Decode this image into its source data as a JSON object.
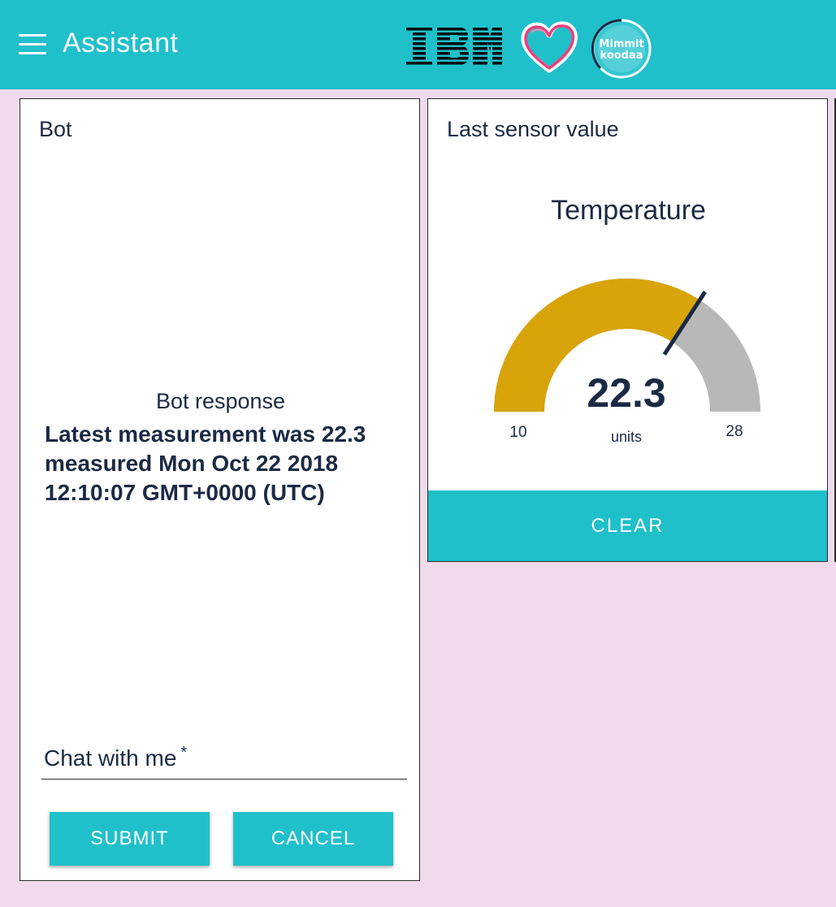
{
  "header": {
    "title": "Assistant",
    "logos": [
      "IBM",
      "heart",
      "Mimmit koodaa"
    ],
    "mimmit_line1": "Mimmit",
    "mimmit_line2": "koodaa"
  },
  "bot_card": {
    "title": "Bot",
    "response_label": "Bot response",
    "response_text": "Latest measurement was 22.3 measured Mon Oct 22 2018 12:10:07 GMT+0000 (UTC)",
    "chat_placeholder": "Chat with me",
    "chat_required_mark": "*",
    "chat_value": "",
    "submit_label": "SUBMIT",
    "cancel_label": "CANCEL"
  },
  "sensor_card": {
    "title": "Last sensor value",
    "gauge": {
      "label": "Temperature",
      "value": 22.3,
      "value_text": "22.3",
      "units": "units",
      "min": 10,
      "max": 28,
      "min_text": "10",
      "max_text": "28",
      "fill_color": "#d8a40a",
      "track_color": "#b8b8b8",
      "needle_color": "#1b2a44"
    },
    "clear_label": "CLEAR"
  },
  "colors": {
    "accent": "#1fc0ca",
    "background": "#f0dbec",
    "text": "#1b2a44"
  }
}
